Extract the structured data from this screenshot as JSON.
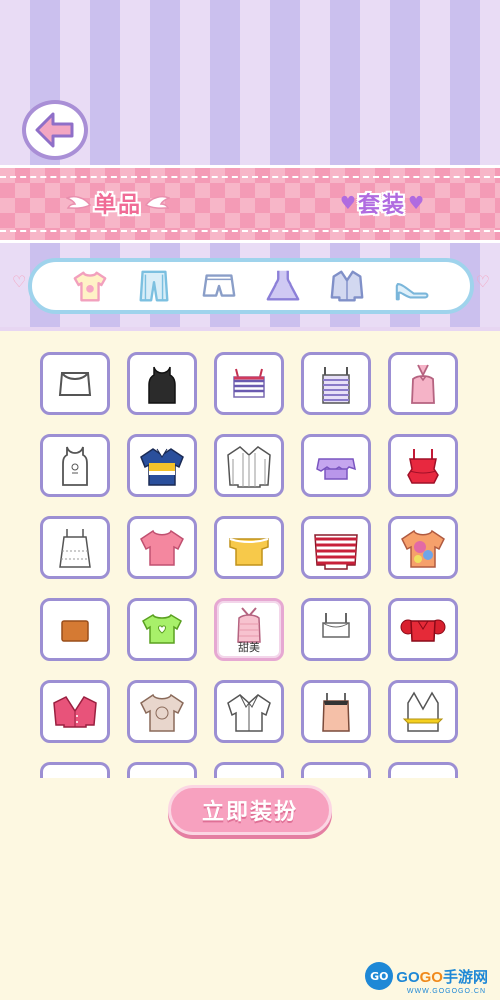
{
  "header": {
    "tabs": [
      {
        "label": "单品",
        "active": true
      },
      {
        "label": "套装",
        "active": false
      }
    ]
  },
  "categories": [
    {
      "icon": "tshirt-icon",
      "active": true
    },
    {
      "icon": "pants-icon",
      "active": false
    },
    {
      "icon": "shorts-icon",
      "active": false
    },
    {
      "icon": "dress-icon",
      "active": false
    },
    {
      "icon": "jacket-icon",
      "active": false
    },
    {
      "icon": "heels-icon",
      "active": false
    }
  ],
  "items": [
    {
      "icon": "white-crop-top-icon"
    },
    {
      "icon": "black-tank-top-icon"
    },
    {
      "icon": "striped-crop-cami-icon"
    },
    {
      "icon": "purple-striped-cami-icon"
    },
    {
      "icon": "pink-halter-top-icon"
    },
    {
      "icon": "white-graphic-tank-icon"
    },
    {
      "icon": "blue-yellow-polo-icon"
    },
    {
      "icon": "white-striped-blouse-icon"
    },
    {
      "icon": "purple-ruffle-top-icon"
    },
    {
      "icon": "red-ruffle-cami-icon"
    },
    {
      "icon": "white-lace-cami-icon"
    },
    {
      "icon": "pink-tee-icon"
    },
    {
      "icon": "yellow-offshoulder-top-icon"
    },
    {
      "icon": "red-striped-offshoulder-icon"
    },
    {
      "icon": "tie-dye-tee-icon"
    },
    {
      "icon": "orange-tube-top-icon"
    },
    {
      "icon": "green-heart-crop-tee-icon"
    },
    {
      "icon": "pink-halter-icon",
      "label": "甜美",
      "selected": true
    },
    {
      "icon": "white-sports-bra-icon"
    },
    {
      "icon": "red-puff-crop-top-icon"
    },
    {
      "icon": "pink-cardigan-icon"
    },
    {
      "icon": "beige-print-tee-icon"
    },
    {
      "icon": "white-shirt-icon"
    },
    {
      "icon": "peach-lace-cami-icon"
    },
    {
      "icon": "white-wrap-top-icon"
    }
  ],
  "apply_button": {
    "label": "立即装扮"
  },
  "watermark": {
    "brand_a": "GO",
    "brand_b": "GO",
    "brand_c": "手游网",
    "sub": "WWW.GOGOGO.CN"
  },
  "colors": {
    "accent": "#f06b96",
    "border": "#9c8fd3",
    "background": "#fdf8e1"
  }
}
